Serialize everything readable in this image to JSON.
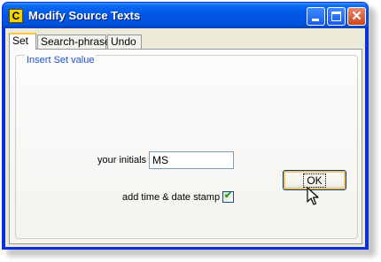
{
  "window": {
    "title": "Modify Source Texts",
    "app_icon_glyph": "C",
    "controls": {
      "minimize": "minimize-icon",
      "maximize": "maximize-icon",
      "close": "close-icon",
      "close_glyph": "✕"
    }
  },
  "tabs": [
    {
      "label": "Set",
      "active": true
    },
    {
      "label": "Search-phrase",
      "active": false
    },
    {
      "label": "Undo",
      "active": false
    }
  ],
  "group": {
    "label": "Insert Set value"
  },
  "form": {
    "initials_label": "your initials",
    "initials_value": "MS",
    "stamp_label": "add time & date stamp",
    "stamp_checked": true,
    "check_glyph": "✔"
  },
  "buttons": {
    "ok_label": "OK"
  },
  "colors": {
    "titlebar": "#0054e3",
    "accent_tab": "#ffc83c",
    "group_label": "#1f4fd0",
    "checkmark": "#21a121",
    "close_button": "#c9461d"
  }
}
